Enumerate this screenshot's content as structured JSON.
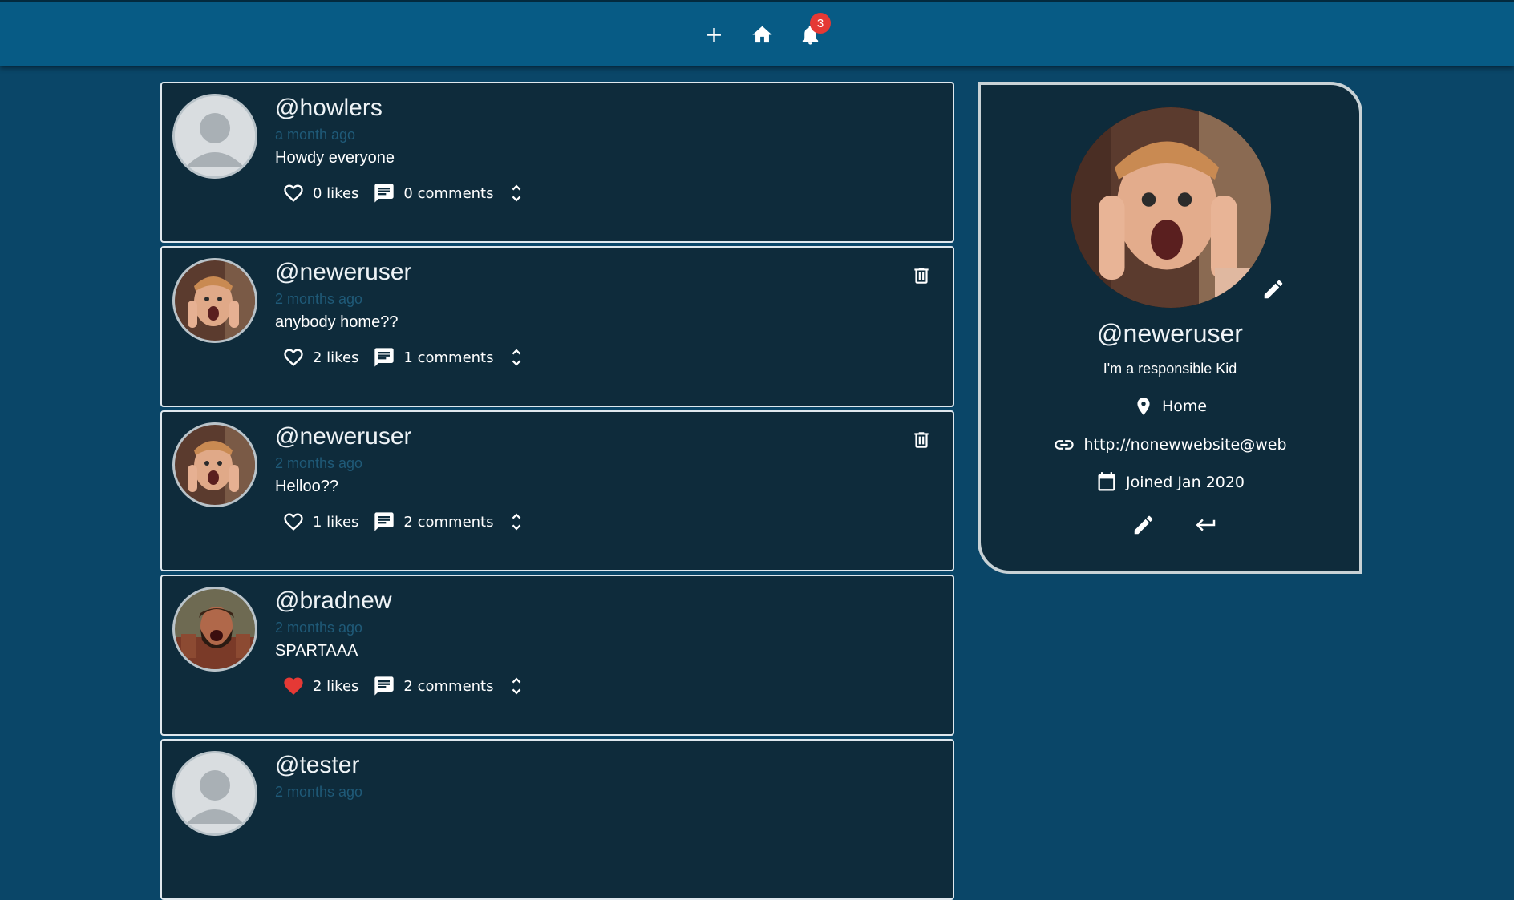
{
  "nav": {
    "notification_count": "3"
  },
  "posts": [
    {
      "handle": "@howlers",
      "time": "a month ago",
      "body": "Howdy everyone",
      "likes": "0 likes",
      "comments": "0 comments",
      "liked": false,
      "avatar": "default-avatar",
      "deletable": false
    },
    {
      "handle": "@neweruser",
      "time": "2 months ago",
      "body": "anybody home??",
      "likes": "2 likes",
      "comments": "1 comments",
      "liked": false,
      "avatar": "kid-photo",
      "deletable": true
    },
    {
      "handle": "@neweruser",
      "time": "2 months ago",
      "body": "Helloo??",
      "likes": "1 likes",
      "comments": "2 comments",
      "liked": false,
      "avatar": "kid-photo",
      "deletable": true
    },
    {
      "handle": "@bradnew",
      "time": "2 months ago",
      "body": "SPARTAAA",
      "likes": "2 likes",
      "comments": "2 comments",
      "liked": true,
      "avatar": "spartan-photo",
      "deletable": false
    },
    {
      "handle": "@tester",
      "time": "2 months ago",
      "body": "",
      "likes": "",
      "comments": "",
      "liked": false,
      "avatar": "default-avatar",
      "deletable": false
    }
  ],
  "profile": {
    "handle": "@neweruser",
    "bio": "I'm a responsible Kid",
    "location": "Home",
    "website": "http://nonewwebsite@web",
    "joined": "Joined Jan 2020"
  },
  "colors": {
    "page_background": "#0a4668",
    "topbar": "#075b85",
    "card": "#0e2b3b",
    "like_active": "#e53935",
    "timestamp": "#1f5a78"
  }
}
